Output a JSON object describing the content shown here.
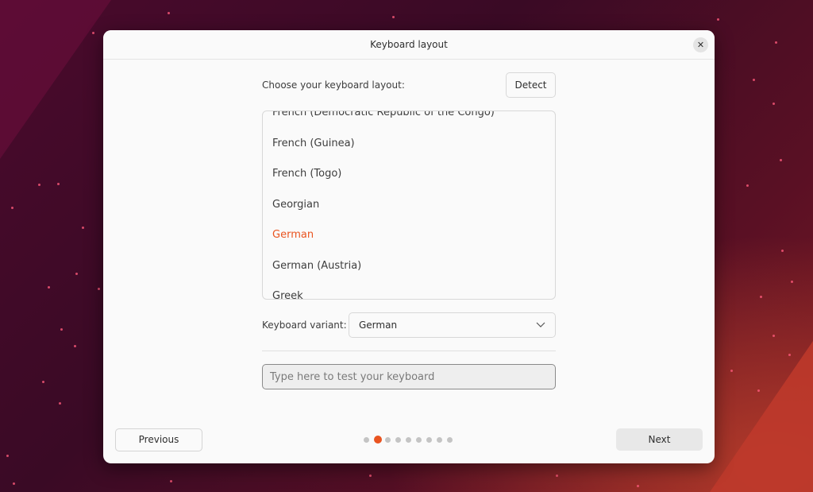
{
  "window": {
    "title": "Keyboard layout"
  },
  "layout": {
    "prompt": "Choose your keyboard layout:",
    "detect_label": "Detect",
    "items": [
      "French (Democratic Republic of the Congo)",
      "French (Guinea)",
      "French (Togo)",
      "Georgian",
      "German",
      "German (Austria)",
      "Greek"
    ],
    "selected": "German"
  },
  "variant": {
    "label": "Keyboard variant:",
    "value": "German"
  },
  "test": {
    "placeholder": "Type here to test your keyboard"
  },
  "nav": {
    "previous_label": "Previous",
    "next_label": "Next",
    "total_steps": 9,
    "current_step": 2
  },
  "colors": {
    "accent": "#e95420"
  },
  "icons": {
    "close": "close-icon",
    "dropdown": "chevron-down-icon"
  }
}
